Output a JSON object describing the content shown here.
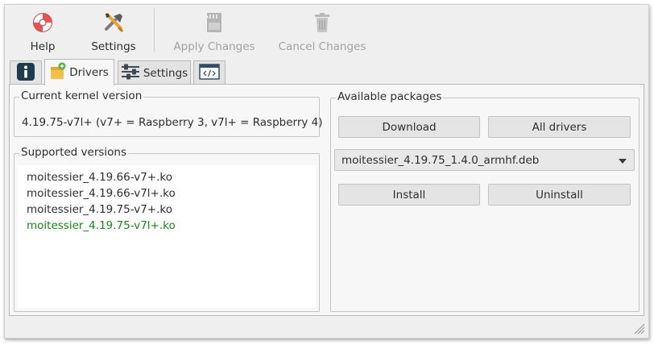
{
  "toolbar": {
    "help_label": "Help",
    "settings_label": "Settings",
    "apply_label": "Apply Changes",
    "cancel_label": "Cancel Changes"
  },
  "tabs": [
    {
      "label": "",
      "icon": "info-icon",
      "active": false
    },
    {
      "label": "Drivers",
      "icon": "drivers-icon",
      "active": true
    },
    {
      "label": "Settings",
      "icon": "sliders-icon",
      "active": false
    },
    {
      "label": "",
      "icon": "code-window-icon",
      "active": false
    }
  ],
  "kernel": {
    "title": "Current kernel version",
    "value": "4.19.75-v7l+ (v7+ = Raspberry 3, v7l+ = Raspberry 4)"
  },
  "supported": {
    "title": "Supported versions",
    "items": [
      "moitessier_4.19.66-v7+.ko",
      "moitessier_4.19.66-v7l+.ko",
      "moitessier_4.19.75-v7+.ko",
      "moitessier_4.19.75-v7l+.ko"
    ],
    "highlight_color": "#178a17"
  },
  "packages": {
    "title": "Available packages",
    "download_label": "Download",
    "all_drivers_label": "All drivers",
    "selected_package": "moitessier_4.19.75_1.4.0_armhf.deb",
    "install_label": "Install",
    "uninstall_label": "Uninstall"
  }
}
